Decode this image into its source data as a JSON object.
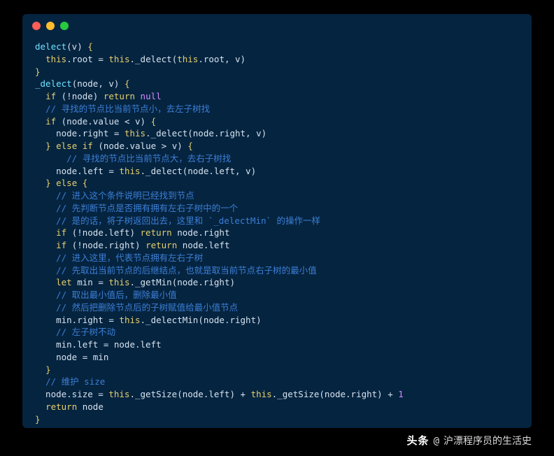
{
  "window": {
    "dots": {
      "red": "#ff5f56",
      "yellow": "#ffbd2e",
      "green": "#27c93f"
    }
  },
  "code": {
    "lines": [
      [
        {
          "t": "delect",
          "c": "fn"
        },
        {
          "t": "(v) ",
          "c": "op"
        },
        {
          "t": "{",
          "c": "br"
        }
      ],
      [
        {
          "t": "  ",
          "c": "op"
        },
        {
          "t": "this",
          "c": "kw"
        },
        {
          "t": ".root = ",
          "c": "op"
        },
        {
          "t": "this",
          "c": "kw"
        },
        {
          "t": "._delect(",
          "c": "op"
        },
        {
          "t": "this",
          "c": "kw"
        },
        {
          "t": ".root, v)",
          "c": "op"
        }
      ],
      [
        {
          "t": "}",
          "c": "br"
        }
      ],
      [
        {
          "t": "_delect",
          "c": "fn"
        },
        {
          "t": "(node, v) ",
          "c": "op"
        },
        {
          "t": "{",
          "c": "br"
        }
      ],
      [
        {
          "t": "  ",
          "c": "op"
        },
        {
          "t": "if",
          "c": "kw"
        },
        {
          "t": " (!node) ",
          "c": "op"
        },
        {
          "t": "return",
          "c": "kw"
        },
        {
          "t": " ",
          "c": "op"
        },
        {
          "t": "null",
          "c": "null"
        }
      ],
      [
        {
          "t": "  ",
          "c": "op"
        },
        {
          "t": "// 寻找的节点比当前节点小，去左子树找",
          "c": "cm"
        }
      ],
      [
        {
          "t": "  ",
          "c": "op"
        },
        {
          "t": "if",
          "c": "kw"
        },
        {
          "t": " (node.value < v) ",
          "c": "op"
        },
        {
          "t": "{",
          "c": "br"
        }
      ],
      [
        {
          "t": "    node.right = ",
          "c": "op"
        },
        {
          "t": "this",
          "c": "kw"
        },
        {
          "t": "._delect(node.right, v)",
          "c": "op"
        }
      ],
      [
        {
          "t": "  ",
          "c": "op"
        },
        {
          "t": "}",
          "c": "br"
        },
        {
          "t": " ",
          "c": "op"
        },
        {
          "t": "else",
          "c": "kw"
        },
        {
          "t": " ",
          "c": "op"
        },
        {
          "t": "if",
          "c": "kw"
        },
        {
          "t": " (node.value > v) ",
          "c": "op"
        },
        {
          "t": "{",
          "c": "br"
        }
      ],
      [
        {
          "t": "      ",
          "c": "op"
        },
        {
          "t": "// 寻找的节点比当前节点大，去右子树找",
          "c": "cm"
        }
      ],
      [
        {
          "t": "    node.left = ",
          "c": "op"
        },
        {
          "t": "this",
          "c": "kw"
        },
        {
          "t": "._delect(node.left, v)",
          "c": "op"
        }
      ],
      [
        {
          "t": "  ",
          "c": "op"
        },
        {
          "t": "}",
          "c": "br"
        },
        {
          "t": " ",
          "c": "op"
        },
        {
          "t": "else",
          "c": "kw"
        },
        {
          "t": " ",
          "c": "op"
        },
        {
          "t": "{",
          "c": "br"
        }
      ],
      [
        {
          "t": "    ",
          "c": "op"
        },
        {
          "t": "// 进入这个条件说明已经找到节点",
          "c": "cm"
        }
      ],
      [
        {
          "t": "    ",
          "c": "op"
        },
        {
          "t": "// 先判断节点是否拥有拥有左右子树中的一个",
          "c": "cm"
        }
      ],
      [
        {
          "t": "    ",
          "c": "op"
        },
        {
          "t": "// 是的话，将子树返回出去，这里和 `_delectMin` 的操作一样",
          "c": "cm"
        }
      ],
      [
        {
          "t": "    ",
          "c": "op"
        },
        {
          "t": "if",
          "c": "kw"
        },
        {
          "t": " (!node.left) ",
          "c": "op"
        },
        {
          "t": "return",
          "c": "kw"
        },
        {
          "t": " node.right",
          "c": "op"
        }
      ],
      [
        {
          "t": "    ",
          "c": "op"
        },
        {
          "t": "if",
          "c": "kw"
        },
        {
          "t": " (!node.right) ",
          "c": "op"
        },
        {
          "t": "return",
          "c": "kw"
        },
        {
          "t": " node.left",
          "c": "op"
        }
      ],
      [
        {
          "t": "    ",
          "c": "op"
        },
        {
          "t": "// 进入这里，代表节点拥有左右子树",
          "c": "cm"
        }
      ],
      [
        {
          "t": "    ",
          "c": "op"
        },
        {
          "t": "// 先取出当前节点的后继结点，也就是取当前节点右子树的最小值",
          "c": "cm"
        }
      ],
      [
        {
          "t": "    ",
          "c": "op"
        },
        {
          "t": "let",
          "c": "kw"
        },
        {
          "t": " min = ",
          "c": "op"
        },
        {
          "t": "this",
          "c": "kw"
        },
        {
          "t": "._getMin(node.right)",
          "c": "op"
        }
      ],
      [
        {
          "t": "    ",
          "c": "op"
        },
        {
          "t": "// 取出最小值后，删除最小值",
          "c": "cm"
        }
      ],
      [
        {
          "t": "    ",
          "c": "op"
        },
        {
          "t": "// 然后把删除节点后的子树赋值给最小值节点",
          "c": "cm"
        }
      ],
      [
        {
          "t": "    min.right = ",
          "c": "op"
        },
        {
          "t": "this",
          "c": "kw"
        },
        {
          "t": "._delectMin(node.right)",
          "c": "op"
        }
      ],
      [
        {
          "t": "    ",
          "c": "op"
        },
        {
          "t": "// 左子树不动",
          "c": "cm"
        }
      ],
      [
        {
          "t": "    min.left = node.left",
          "c": "op"
        }
      ],
      [
        {
          "t": "    node = min",
          "c": "op"
        }
      ],
      [
        {
          "t": "  ",
          "c": "op"
        },
        {
          "t": "}",
          "c": "br"
        }
      ],
      [
        {
          "t": "  ",
          "c": "op"
        },
        {
          "t": "// 维护 size",
          "c": "cm"
        }
      ],
      [
        {
          "t": "  node.size = ",
          "c": "op"
        },
        {
          "t": "this",
          "c": "kw"
        },
        {
          "t": "._getSize(node.left) + ",
          "c": "op"
        },
        {
          "t": "this",
          "c": "kw"
        },
        {
          "t": "._getSize(node.right) + ",
          "c": "op"
        },
        {
          "t": "1",
          "c": "num"
        }
      ],
      [
        {
          "t": "  ",
          "c": "op"
        },
        {
          "t": "return",
          "c": "kw"
        },
        {
          "t": " node",
          "c": "op"
        }
      ],
      [
        {
          "t": "}",
          "c": "br"
        }
      ]
    ]
  },
  "footer": {
    "brand": "头条",
    "at": "@",
    "author": "沪漂程序员的生活史"
  }
}
